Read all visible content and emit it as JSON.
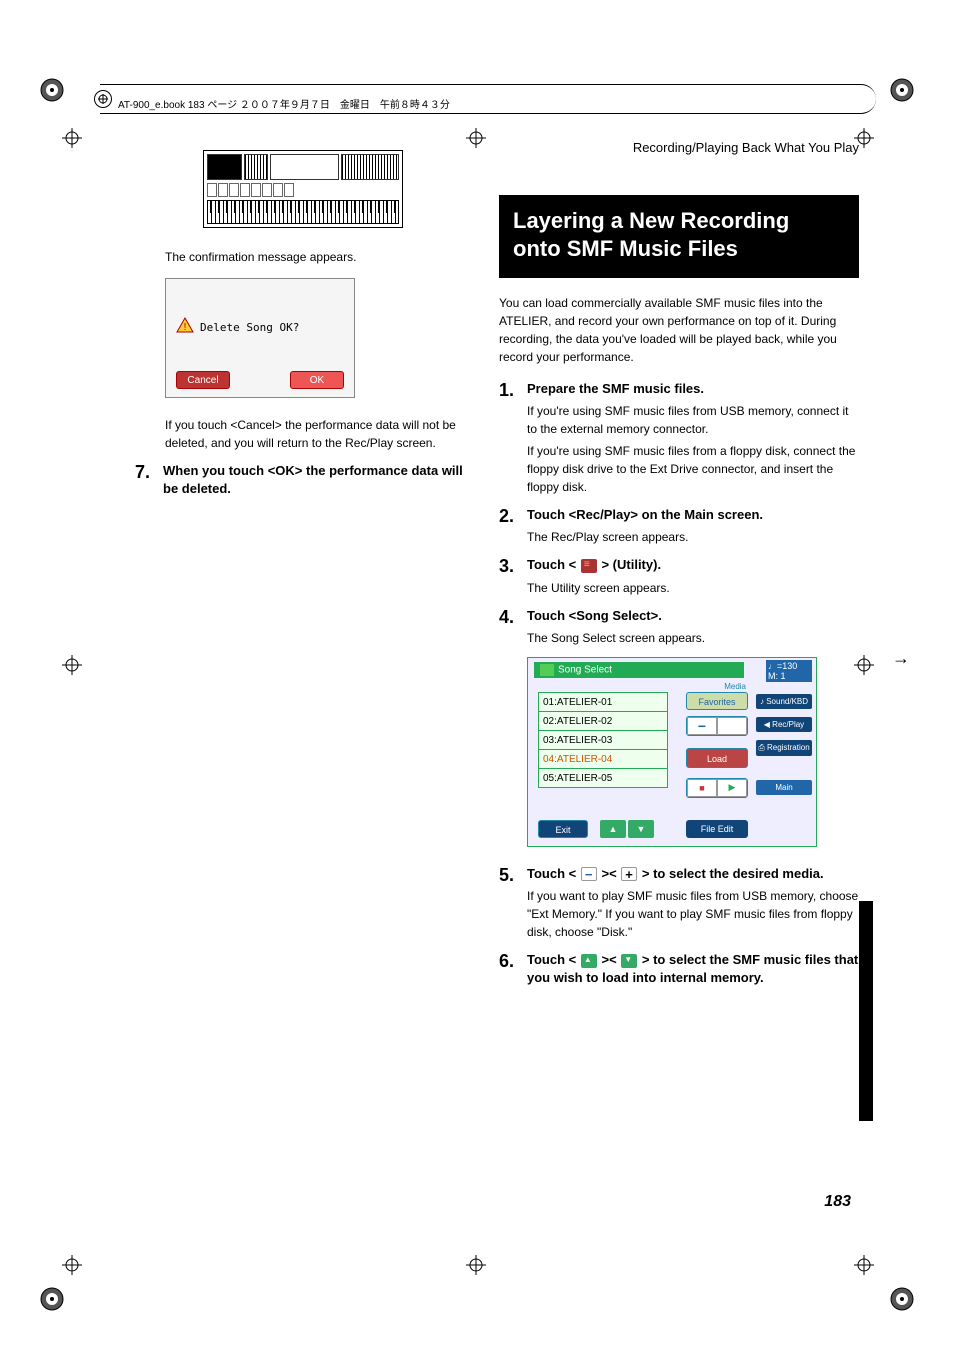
{
  "header": {
    "book_info": "AT-900_e.book  183 ページ  ２００７年９月７日　金曜日　午前８時４３分"
  },
  "left": {
    "confirm_msg": "The confirmation message appears.",
    "dialog": {
      "message": "Delete Song OK?",
      "cancel": "Cancel",
      "ok": "OK"
    },
    "cancel_note": "If you touch <Cancel> the performance data will not be deleted, and you will return to the Rec/Play screen.",
    "step7": {
      "num": "7.",
      "title": "When you touch <OK> the performance data will be deleted."
    }
  },
  "right": {
    "section_header": "Recording/Playing Back What You Play",
    "title_line1": "Layering a New Recording",
    "title_line2": "onto SMF Music Files",
    "intro": "You can load commercially available SMF music files into the ATELIER, and record your own performance on top of it. During recording, the data you've loaded will be played back, while you record your performance.",
    "steps": {
      "s1": {
        "num": "1.",
        "title": "Prepare the SMF music files.",
        "t1": "If you're using SMF music files from USB memory, connect it to the external memory connector.",
        "t2": "If you're using SMF music files from a floppy disk, connect the floppy disk drive to the Ext Drive connector, and insert the floppy disk."
      },
      "s2": {
        "num": "2.",
        "title": "Touch <Rec/Play> on the Main screen.",
        "t1": "The Rec/Play screen appears."
      },
      "s3": {
        "num": "3.",
        "title_a": "Touch < ",
        "title_b": " > (Utility).",
        "t1": "The Utility screen appears."
      },
      "s4": {
        "num": "4.",
        "title": "Touch <Song Select>.",
        "t1": "The Song Select screen appears."
      },
      "s5": {
        "num": "5.",
        "title_a": "Touch < ",
        "title_b": " >< ",
        "title_c": " > to select the desired media.",
        "t1": "If you want to play SMF music files from USB memory, choose \"Ext Memory.\" If you want to play SMF music files from floppy disk, choose \"Disk.\""
      },
      "s6": {
        "num": "6.",
        "title_a": "Touch < ",
        "title_b": " >< ",
        "title_c": " > to select the SMF music files that you wish to load into internal memory."
      }
    },
    "song_select": {
      "title": "Song Select",
      "tempo": "♩=130",
      "measure": "M:      1",
      "media": "Media",
      "rows": [
        "01:ATELIER-01",
        "02:ATELIER-02",
        "03:ATELIER-03",
        "04:ATELIER-04",
        "05:ATELIER-05"
      ],
      "favorites": "Favorites",
      "load": "Load",
      "exit": "Exit",
      "file_edit": "File Edit",
      "side": {
        "sound": "♪ Sound/KBD",
        "rec": "◀ Rec/Play",
        "reg": "⎙ Registration",
        "main": "Main"
      }
    }
  },
  "footer": {
    "page_num": "183",
    "side_text": "Recording/Playing Back What You Play"
  }
}
